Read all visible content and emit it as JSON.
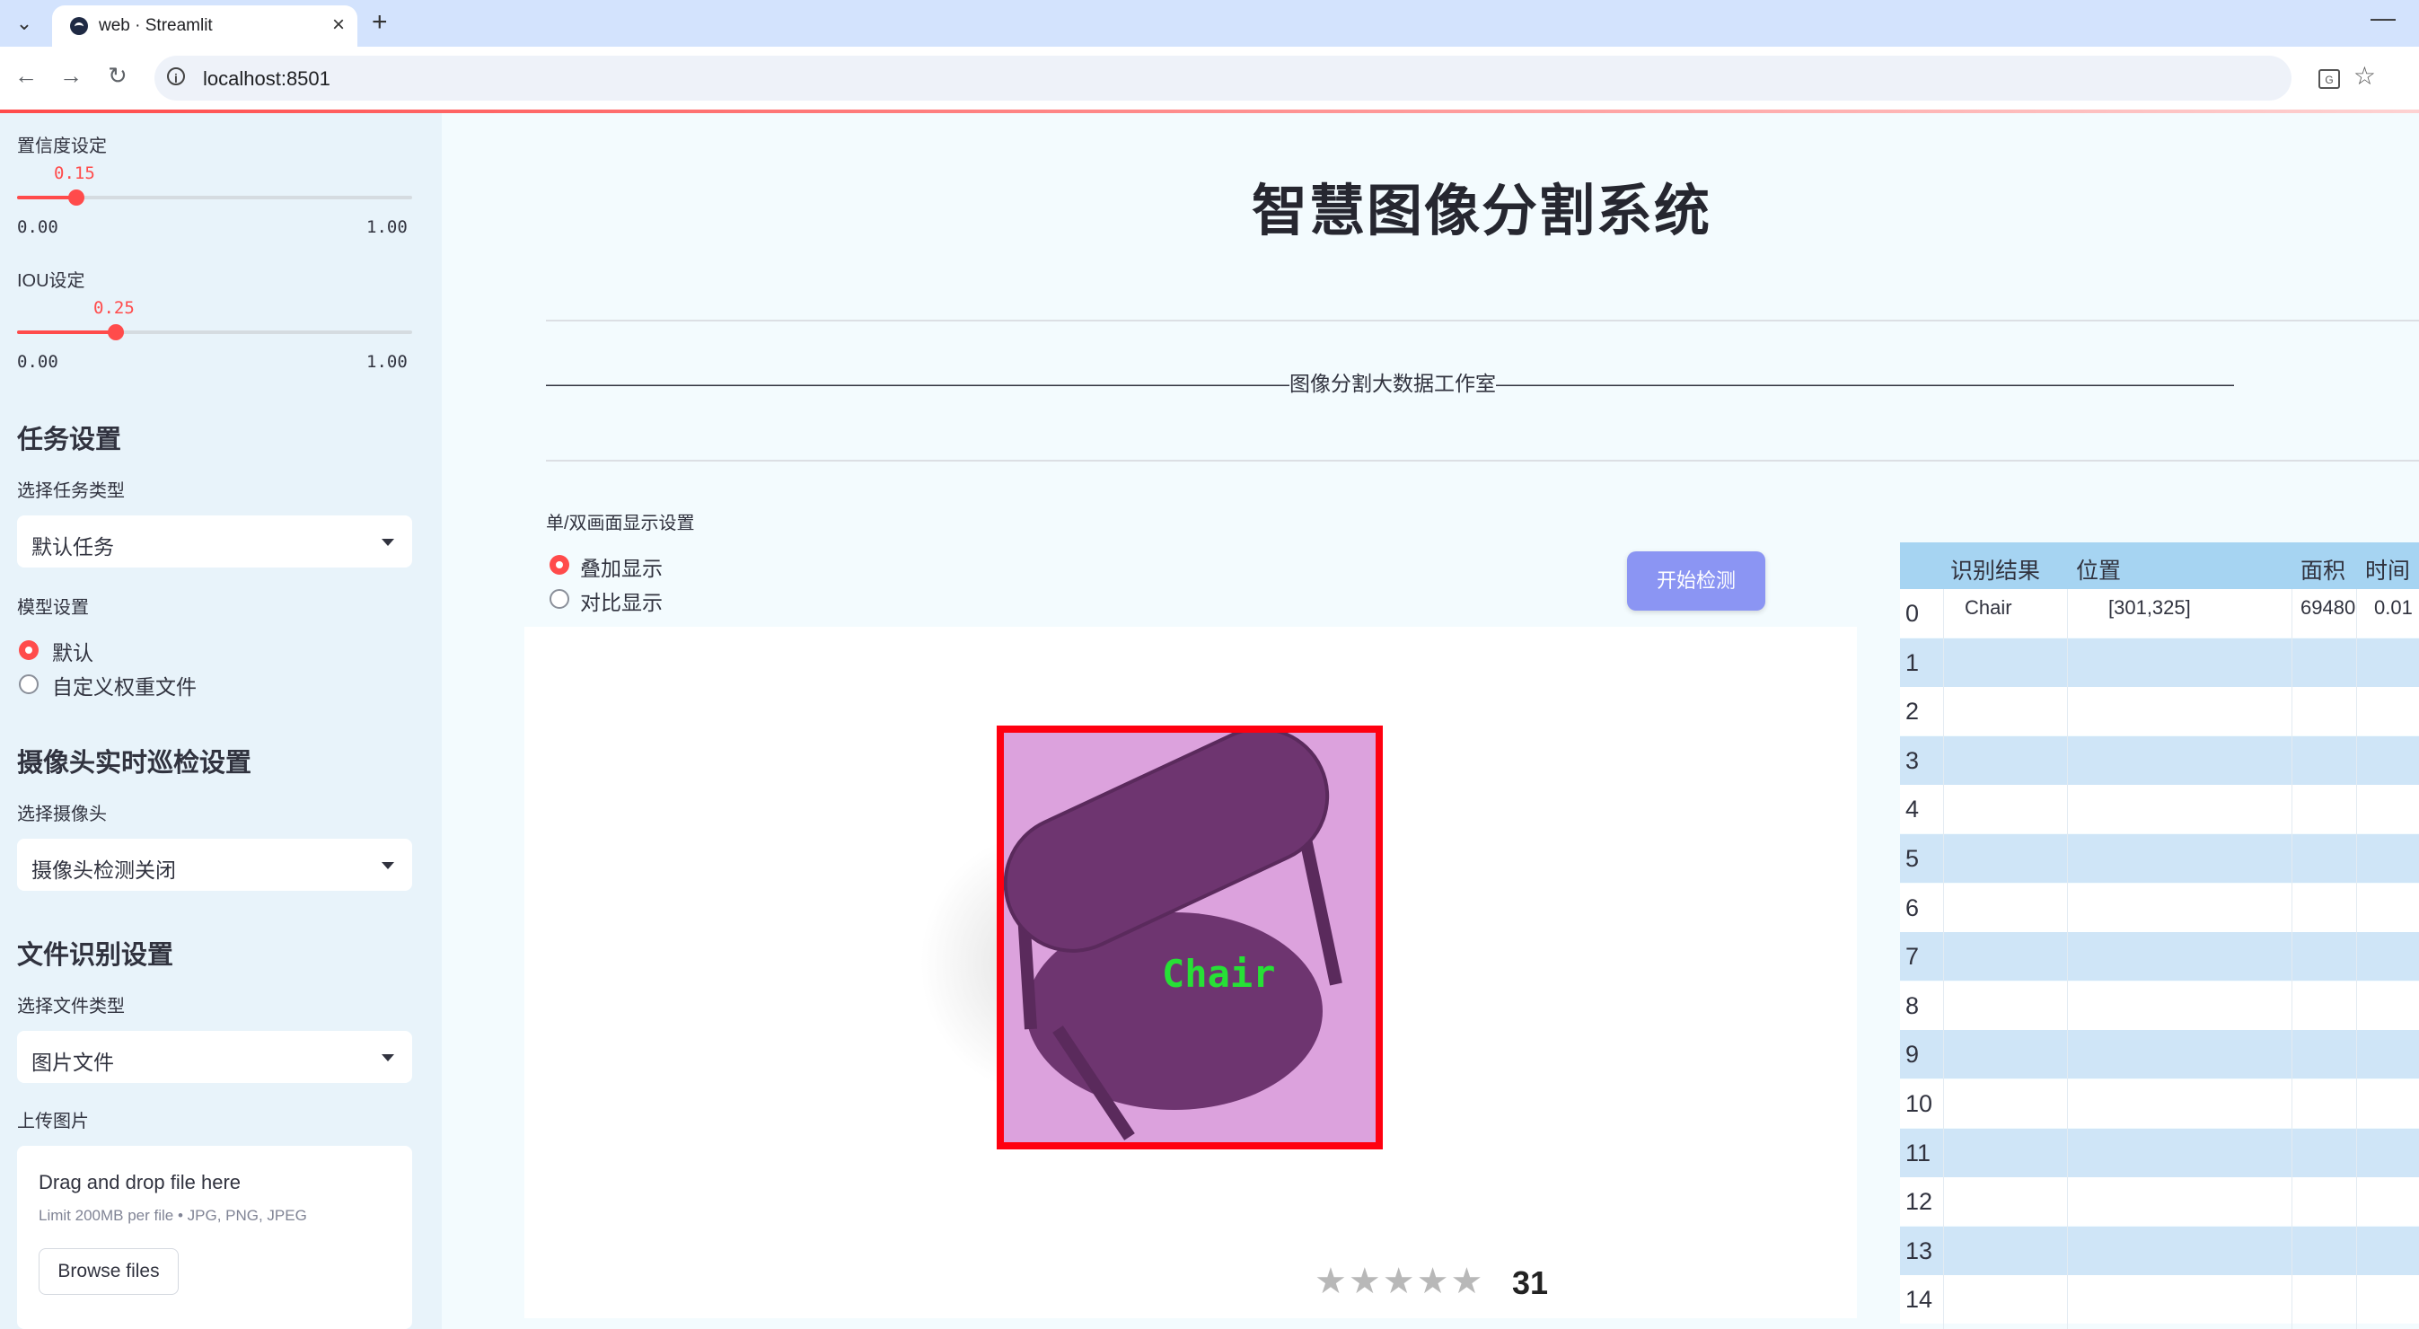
{
  "browser": {
    "tab_title": "web · Streamlit",
    "url": "localhost:8501"
  },
  "sidebar": {
    "confidence": {
      "label": "置信度设定",
      "value": "0.15",
      "value_num": 0.15,
      "min": "0.00",
      "max": "1.00"
    },
    "iou": {
      "label": "IOU设定",
      "value": "0.25",
      "value_num": 0.25,
      "min": "0.00",
      "max": "1.00"
    },
    "task_section": "任务设置",
    "task_type_label": "选择任务类型",
    "task_type_value": "默认任务",
    "model_label": "模型设置",
    "model_options": [
      "默认",
      "自定义权重文件"
    ],
    "model_selected": 0,
    "camera_section": "摄像头实时巡检设置",
    "camera_label": "选择摄像头",
    "camera_value": "摄像头检测关闭",
    "file_section": "文件识别设置",
    "file_type_label": "选择文件类型",
    "file_type_value": "图片文件",
    "upload_label": "上传图片",
    "upload": {
      "title": "Drag and drop file here",
      "limit": "Limit 200MB per file • JPG, PNG, JPEG",
      "button": "Browse files"
    }
  },
  "main": {
    "title": "智慧图像分割系统",
    "banner": "————————————————————————————————————图像分割大数据工作室—————————————————————————————————————",
    "display_label": "单/双画面显示设置",
    "display_options": [
      "叠加显示",
      "对比显示"
    ],
    "display_selected": 0,
    "detect_button": "开始检测",
    "detection_label": "Chair",
    "image_rating": "31",
    "stars": "★★★★★"
  },
  "table": {
    "columns": [
      "识别结果",
      "位置",
      "面积",
      "时间"
    ],
    "rows": [
      {
        "idx": "0",
        "result": "Chair",
        "position": "[301,325]",
        "area": "69480",
        "time": "0.01"
      },
      {
        "idx": "1"
      },
      {
        "idx": "2"
      },
      {
        "idx": "3"
      },
      {
        "idx": "4"
      },
      {
        "idx": "5"
      },
      {
        "idx": "6"
      },
      {
        "idx": "7"
      },
      {
        "idx": "8"
      },
      {
        "idx": "9"
      },
      {
        "idx": "10"
      },
      {
        "idx": "11"
      },
      {
        "idx": "12"
      },
      {
        "idx": "13"
      },
      {
        "idx": "14"
      }
    ]
  },
  "colors": {
    "accent": "#ff4b4b",
    "button": "#8b95f3",
    "detection_box": "#ff0010",
    "detection_text": "#27e036",
    "mask": "#dca2dd",
    "table_header": "#a6d4f2"
  }
}
